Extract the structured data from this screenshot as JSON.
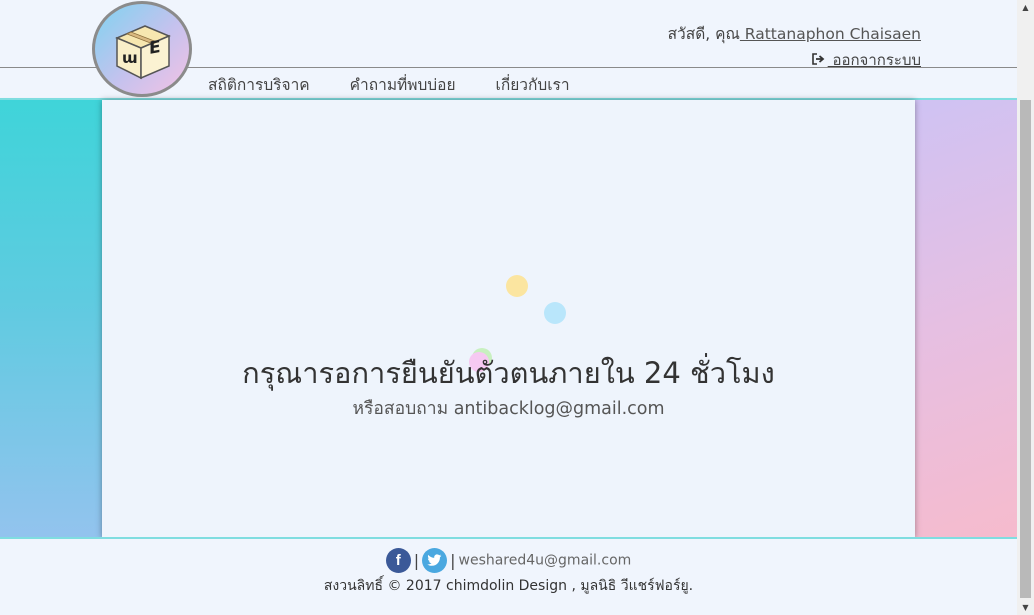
{
  "header": {
    "greeting_prefix": "สวัสดี, คุณ",
    "user_name": " Rattanaphon Chaisaen",
    "logout_label": " ออกจากระบบ",
    "nav": [
      {
        "label": "สถิติการบริจาค"
      },
      {
        "label": "คำถามที่พบบ่อย"
      },
      {
        "label": "เกี่ยวกับเรา"
      }
    ],
    "logo_letters": [
      "ɯ",
      "E"
    ]
  },
  "main": {
    "title": "กรุณารอการยืนยันตัวตนภายใน 24 ชั่วโมง",
    "subtitle": "หรือสอบถาม antibacklog@gmail.com",
    "loader_colors": [
      "#fbe5a0",
      "#b9e6fb",
      "#c8f0c0",
      "#f6c9f2"
    ]
  },
  "footer": {
    "email": "weshared4u@gmail.com",
    "copyright": "สงวนลิทธิ์ © 2017 chimdolin Design , มูลนิธิ วีแชร์ฟอร์ยู.",
    "separator": "|"
  },
  "colors": {
    "page_bg": "#f0f5fd",
    "accent_cyan": "#7fdde0",
    "facebook": "#3b5998",
    "twitter": "#4aa8e0"
  },
  "icons": {
    "logout": "sign-out-icon",
    "facebook": "facebook-icon",
    "twitter": "twitter-icon",
    "scroll_up": "scroll-up-arrow",
    "scroll_down": "scroll-down-arrow"
  }
}
